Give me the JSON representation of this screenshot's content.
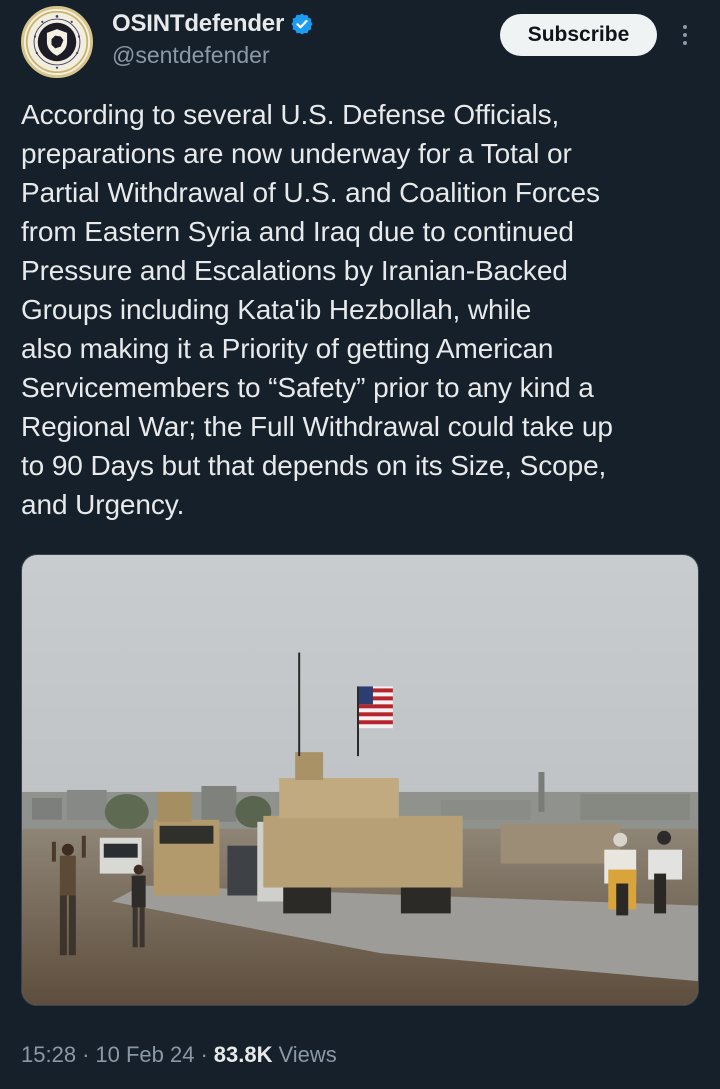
{
  "author": {
    "display_name": "OSINTdefender",
    "handle": "@sentdefender",
    "verified": true,
    "avatar_icon": "shield-emblem-icon"
  },
  "actions": {
    "subscribe_label": "Subscribe",
    "more_icon": "more-vertical-icon"
  },
  "tweet": {
    "text": "According to several U.S. Defense Officials,\npreparations are now underway for a Total or\nPartial Withdrawal of U.S. and Coalition Forces\nfrom Eastern Syria and Iraq due to continued\nPressure and Escalations by Iranian-Backed\nGroups including Kata'ib Hezbollah, while\nalso making it a Priority of getting American\nServicemembers to “Safety” prior to any kind a\nRegional War; the Full Withdrawal could take up\nto 90 Days but that depends on its Size, Scope,\nand Urgency."
  },
  "meta": {
    "time": "15:28",
    "date": "10 Feb 24",
    "views_count": "83.8K",
    "views_label": "Views"
  },
  "colors": {
    "background": "#15202b",
    "text": "#e7e9ea",
    "secondary": "#8b98a5",
    "verified_blue": "#1d9bf0",
    "button_bg": "#eff3f4"
  }
}
